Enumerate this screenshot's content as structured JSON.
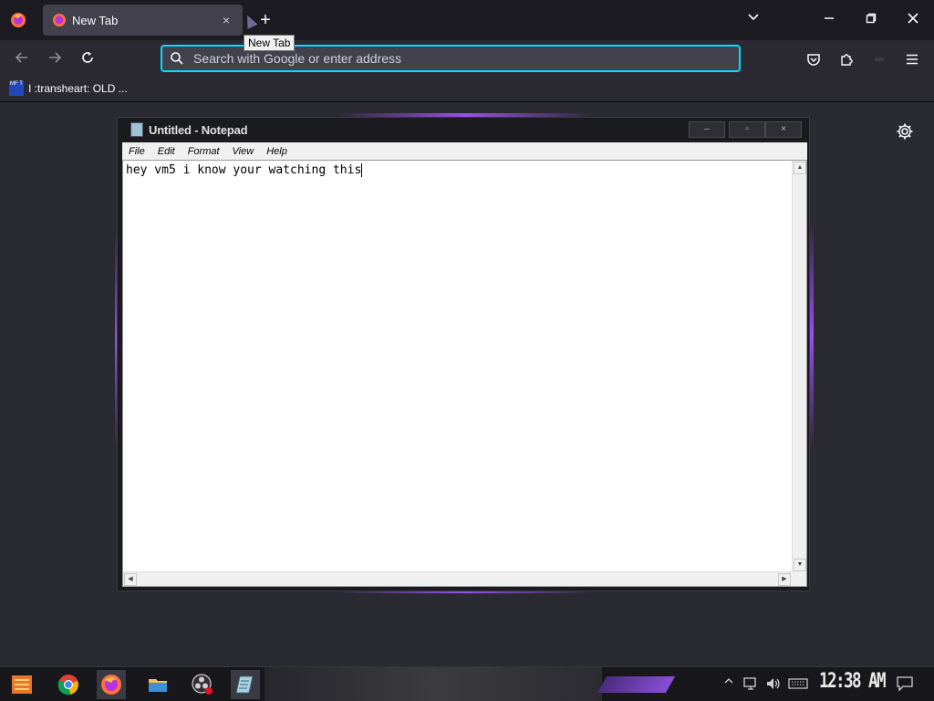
{
  "browser": {
    "tab": {
      "title": "New Tab",
      "close": "×"
    },
    "new_tab_plus": "+",
    "tooltip": "New Tab",
    "list_all_tabs": "⌄",
    "window": {
      "minimize": "—",
      "restore": "❐",
      "close": "✕"
    },
    "nav": {
      "back": "←",
      "forward": "→",
      "reload": "↻"
    },
    "urlbar": {
      "placeholder": "Search with Google or enter address",
      "value": ""
    },
    "bookmarks": [
      {
        "label": "I :transheart: OLD ...",
        "icon_text": "MF T"
      }
    ],
    "accent_color": "#00ddff"
  },
  "notepad": {
    "title": "Untitled - Notepad",
    "controls": {
      "minimize": "–",
      "maximize": "▫",
      "close": "×"
    },
    "menu": [
      "File",
      "Edit",
      "Format",
      "View",
      "Help"
    ],
    "content": "hey vm5 i know your watching this"
  },
  "taskbar": {
    "apps": [
      {
        "name": "start",
        "icon": "start-menu-icon"
      },
      {
        "name": "chrome",
        "icon": "chrome-icon"
      },
      {
        "name": "firefox",
        "icon": "firefox-icon"
      },
      {
        "name": "file-explorer",
        "icon": "folder-icon"
      },
      {
        "name": "obs",
        "icon": "obs-icon"
      },
      {
        "name": "notepad",
        "icon": "notepad-icon"
      }
    ],
    "clock": "12:38 AM"
  }
}
